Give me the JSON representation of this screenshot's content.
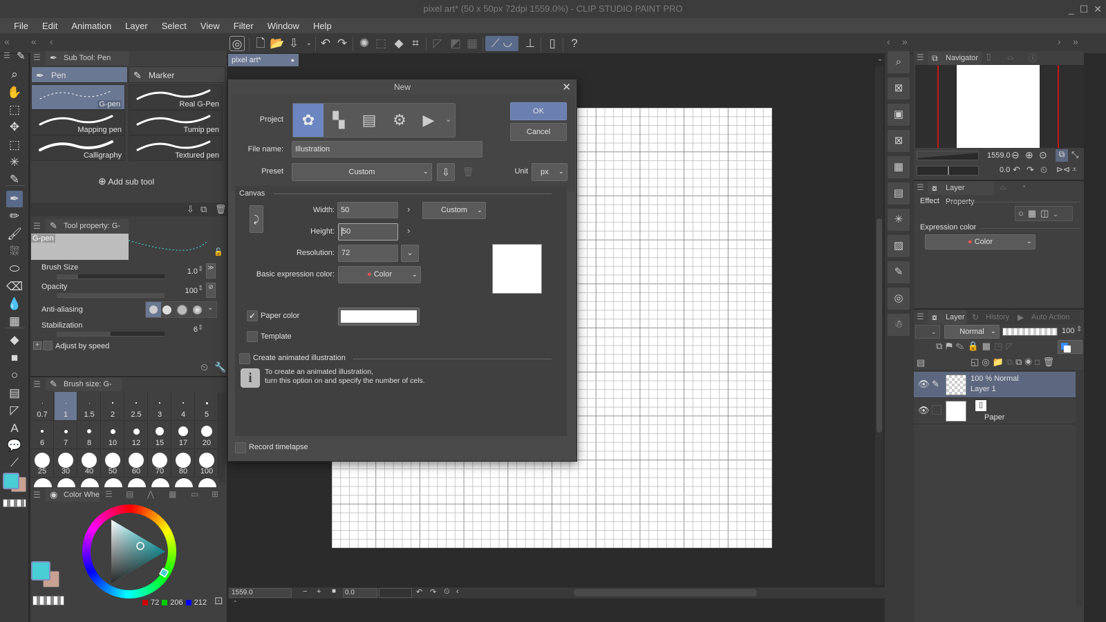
{
  "window": {
    "title": "pixel art* (50 x 50px 72dpi 1559.0%)  - CLIP STUDIO PAINT PRO",
    "controls": [
      "_",
      "☐",
      "✕"
    ]
  },
  "menu": [
    "File",
    "Edit",
    "Animation",
    "Layer",
    "Select",
    "View",
    "Filter",
    "Window",
    "Help"
  ],
  "command_bar": {
    "icons": [
      "clip-studio-icon",
      "new-file-icon",
      "open-file-icon",
      "save-icon",
      "undo-icon",
      "redo-icon",
      "clear-selection-icon",
      "invert-selection-icon",
      "fill-icon",
      "transform-icon",
      "snap-ruler-icon",
      "snap-special-ruler-icon",
      "snap-grid-icon",
      "ruler-snap-active-icon",
      "curve-snap-active-icon",
      "perspective-ruler-icon",
      "smartphone-icon",
      "help-icon"
    ]
  },
  "tools": [
    {
      "name": "zoom",
      "glyph": "⌕"
    },
    {
      "name": "hand",
      "glyph": "✋"
    },
    {
      "name": "object",
      "glyph": "⬚"
    },
    {
      "name": "move",
      "glyph": "✥"
    },
    {
      "name": "selection",
      "glyph": "⬚"
    },
    {
      "name": "auto-select",
      "glyph": "✳"
    },
    {
      "name": "eyedropper",
      "glyph": "✎"
    },
    {
      "name": "pen",
      "glyph": "✒",
      "active": true
    },
    {
      "name": "pencil",
      "glyph": "✏"
    },
    {
      "name": "brush",
      "glyph": "🖌"
    },
    {
      "name": "airbrush",
      "glyph": "⛆"
    },
    {
      "name": "decoration",
      "glyph": "⬭"
    },
    {
      "name": "eraser",
      "glyph": "⌫"
    },
    {
      "name": "blend",
      "glyph": "💧"
    },
    {
      "name": "liquify",
      "glyph": "▦"
    },
    {
      "name": "fill",
      "glyph": "◆"
    },
    {
      "name": "gradient",
      "glyph": "■"
    },
    {
      "name": "figure",
      "glyph": "○"
    },
    {
      "name": "frame",
      "glyph": "▤"
    },
    {
      "name": "ruler",
      "glyph": "◸"
    },
    {
      "name": "text",
      "glyph": "A"
    },
    {
      "name": "balloon",
      "glyph": "💬"
    },
    {
      "name": "line-correction",
      "glyph": "⟋"
    }
  ],
  "colors": {
    "main": "#48ced4",
    "sub": "#c9a092",
    "accent": "#6b7893",
    "rgb": {
      "r": 72,
      "g": 206,
      "b": 212
    }
  },
  "subtool": {
    "title": "Sub Tool: Pen",
    "categories": [
      {
        "label": "Pen",
        "active": true
      },
      {
        "label": "Marker",
        "active": false
      }
    ],
    "brushes": [
      {
        "label": "G-pen",
        "active": true
      },
      {
        "label": "Real G-Pen",
        "active": false
      },
      {
        "label": "Mapping pen",
        "active": false
      },
      {
        "label": "Tumip pen",
        "active": false
      },
      {
        "label": "Calligraphy",
        "active": false
      },
      {
        "label": "Textured pen",
        "active": false
      }
    ],
    "add_label": "Add sub tool"
  },
  "tool_property": {
    "title": "Tool property: G-pen",
    "preview_label": "G-pen",
    "brush_size": {
      "label": "Brush Size",
      "value": "1.0",
      "fraction": 0.2
    },
    "opacity": {
      "label": "Opacity",
      "value": "100",
      "fraction": 1.0
    },
    "anti_aliasing": {
      "label": "Anti-aliasing",
      "levels": 4,
      "selected": 0
    },
    "stabilization": {
      "label": "Stabilization",
      "value": "6",
      "fraction": 0.5
    },
    "adjust_by_speed": {
      "label": "Adjust by speed",
      "checked": false
    }
  },
  "brush_size_panel": {
    "title": "Brush size: G-pen",
    "sizes": [
      "0.7",
      "1",
      "1.5",
      "2",
      "2.5",
      "3",
      "4",
      "5",
      "6",
      "7",
      "8",
      "10",
      "12",
      "15",
      "17",
      "20",
      "25",
      "30",
      "40",
      "50",
      "60",
      "70",
      "80",
      "100"
    ],
    "selected": "1"
  },
  "color_wheel": {
    "title": "Color Whe",
    "r": "72",
    "g": "206",
    "b": "212"
  },
  "document": {
    "tab_label": "pixel art*",
    "grid_cells": 50,
    "zoom": "1559.0",
    "rotation": "0.0"
  },
  "dialog": {
    "title": "New",
    "project_label": "Project",
    "project_types": [
      "illustration",
      "comic",
      "webtoon",
      "custom-comic",
      "animation"
    ],
    "selected_project": 0,
    "ok": "OK",
    "cancel": "Cancel",
    "file_name_label": "File name:",
    "file_name": "Illustration",
    "preset_label": "Preset",
    "preset": "Custom",
    "unit_label": "Unit",
    "unit": "px",
    "canvas_section": "Canvas",
    "width_label": "Width:",
    "width": "50",
    "height_label": "Height:",
    "height": "50",
    "size_preset": "Custom",
    "resolution_label": "Resolution:",
    "resolution": "72",
    "expression_label": "Basic expression color:",
    "expression": "Color",
    "paper_color_label": "Paper color",
    "paper_color_checked": true,
    "paper_color": "#ffffff",
    "template_label": "Template",
    "template_checked": false,
    "animated_label": "Create animated illustration",
    "animated_checked": false,
    "info_line1": "To create an animated illustration,",
    "info_line2": "turn this option on and specify the number of cels.",
    "timelapse_label": "Record timelapse",
    "timelapse_checked": false
  },
  "navigator": {
    "title": "Navigator",
    "zoom": "1559.0",
    "rotation": "0.0"
  },
  "layer_property": {
    "title": "Layer Property",
    "effect_label": "Effect",
    "expression_label": "Expression color",
    "expression": "Color"
  },
  "layer_panel": {
    "tabs": [
      "Layer",
      "History",
      "Auto Action"
    ],
    "blend_mode": "Normal",
    "opacity": "100",
    "layers": [
      {
        "mode": "100 % Normal",
        "name": "Layer 1",
        "selected": true,
        "visible": true
      },
      {
        "mode": "",
        "name": "Paper",
        "selected": false,
        "visible": true
      }
    ]
  }
}
